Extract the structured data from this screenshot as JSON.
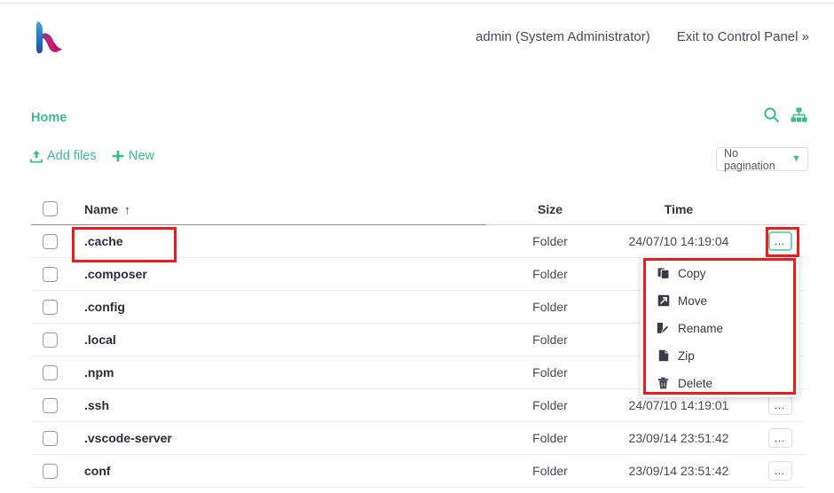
{
  "header": {
    "user_label": "admin (System Administrator)",
    "exit_label": "Exit to Control Panel »",
    "logo_name": "hestia-logo"
  },
  "breadcrumb": {
    "home_label": "Home"
  },
  "toolbar": {
    "add_files_label": "Add files",
    "new_label": "New",
    "search_icon": "search-icon",
    "tree_icon": "sitemap-icon",
    "pagination_label": "No pagination",
    "pagination_chevron": "chevron-down-icon"
  },
  "table": {
    "columns": {
      "name": "Name",
      "size": "Size",
      "time": "Time",
      "sort_arrow": "↑"
    },
    "rows": [
      {
        "name": ".cache",
        "size": "Folder",
        "time": "24/07/10 14:19:04",
        "actions": "…",
        "active": true
      },
      {
        "name": ".composer",
        "size": "Folder",
        "time": "",
        "actions": "…",
        "active": false
      },
      {
        "name": ".config",
        "size": "Folder",
        "time": "",
        "actions": "…",
        "active": false
      },
      {
        "name": ".local",
        "size": "Folder",
        "time": "",
        "actions": "…",
        "active": false
      },
      {
        "name": ".npm",
        "size": "Folder",
        "time": "",
        "actions": "…",
        "active": false
      },
      {
        "name": ".ssh",
        "size": "Folder",
        "time": "24/07/10 14:19:01",
        "actions": "…",
        "active": false
      },
      {
        "name": ".vscode-server",
        "size": "Folder",
        "time": "23/09/14 23:51:42",
        "actions": "…",
        "active": false
      },
      {
        "name": "conf",
        "size": "Folder",
        "time": "23/09/14 23:51:42",
        "actions": "…",
        "active": false
      }
    ]
  },
  "context_menu": {
    "items": [
      {
        "label": "Copy",
        "icon": "copy-icon"
      },
      {
        "label": "Move",
        "icon": "move-icon"
      },
      {
        "label": "Rename",
        "icon": "rename-icon"
      },
      {
        "label": "Zip",
        "icon": "zip-icon"
      },
      {
        "label": "Delete",
        "icon": "trash-icon"
      }
    ]
  },
  "colors": {
    "accent_green": "#3cba92",
    "annotation_red": "#ee1b1b",
    "logo_blue": "#1f7ec6",
    "logo_magenta": "#c9186b"
  }
}
